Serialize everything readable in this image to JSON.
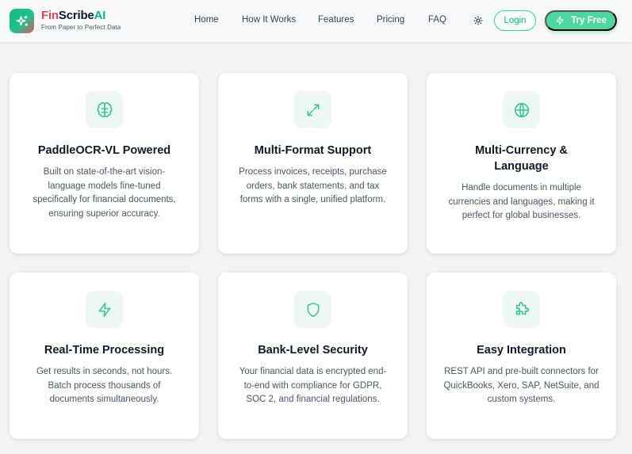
{
  "brand": {
    "name_part1": "Fin",
    "name_part2": "Scribe",
    "name_part3": "AI",
    "tagline": "From Paper to Perfect Data",
    "logo_icon": "sparkles-icon"
  },
  "nav": {
    "links": [
      "Home",
      "How It Works",
      "Features",
      "Pricing",
      "FAQ"
    ],
    "theme_icon": "sun-icon",
    "login_label": "Login",
    "cta_label": "Try Free",
    "cta_icon": "lightning-icon"
  },
  "colors": {
    "accent": "#10b981",
    "accent_light": "#4fd5a0",
    "brand_red": "#e0485a",
    "icon_bg": "#edf8f3"
  },
  "features": [
    {
      "icon": "brain-icon",
      "title": "PaddleOCR-VL Powered",
      "description": "Built on state-of-the-art vision-language models fine-tuned specifically for financial documents, ensuring superior accuracy."
    },
    {
      "icon": "expand-icon",
      "title": "Multi-Format Support",
      "description": "Process invoices, receipts, purchase orders, bank statements, and tax forms with a single, unified platform."
    },
    {
      "icon": "globe-icon",
      "title": "Multi-Currency & Language",
      "description": "Handle documents in multiple currencies and languages, making it perfect for global businesses."
    },
    {
      "icon": "lightning-icon",
      "title": "Real-Time Processing",
      "description": "Get results in seconds, not hours. Batch process thousands of documents simultaneously."
    },
    {
      "icon": "shield-icon",
      "title": "Bank-Level Security",
      "description": "Your financial data is encrypted end-to-end with compliance for GDPR, SOC 2, and financial regulations."
    },
    {
      "icon": "puzzle-icon",
      "title": "Easy Integration",
      "description": "REST API and pre-built connectors for QuickBooks, Xero, SAP, NetSuite, and custom systems."
    }
  ]
}
